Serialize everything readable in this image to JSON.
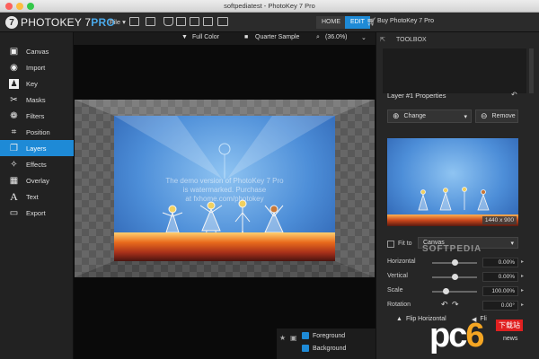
{
  "window": {
    "title": "softpediatest - PhotoKey 7 Pro"
  },
  "app": {
    "logo_num": "7",
    "logo_text": "PHOTOKEY 7",
    "logo_pro": "PRO"
  },
  "menu": {
    "file": "File ▾"
  },
  "tabs": [
    {
      "label": "HOME"
    },
    {
      "label": "EDIT"
    }
  ],
  "buy": "Buy PhotoKey 7 Pro",
  "sidebar": {
    "items": [
      {
        "label": "Canvas",
        "icon": "canvas-icon"
      },
      {
        "label": "Import",
        "icon": "camera-icon"
      },
      {
        "label": "Key",
        "icon": "key-icon"
      },
      {
        "label": "Masks",
        "icon": "scissors-icon"
      },
      {
        "label": "Filters",
        "icon": "filters-icon"
      },
      {
        "label": "Position",
        "icon": "crop-icon"
      },
      {
        "label": "Layers",
        "icon": "layers-icon"
      },
      {
        "label": "Effects",
        "icon": "wand-icon"
      },
      {
        "label": "Overlay",
        "icon": "grid-icon"
      },
      {
        "label": "Text",
        "icon": "text-icon"
      },
      {
        "label": "Export",
        "icon": "export-icon"
      }
    ],
    "active_index": 6
  },
  "canvas_toolbar": {
    "color_mode": "Full Color",
    "sample": "Quarter Sample",
    "zoom": "(36.0%)"
  },
  "canvas": {
    "watermark_lines": [
      "The demo version of PhotoKey 7 Pro",
      "is watermarked. Purchase",
      "at fxhome.com/photokey"
    ]
  },
  "bottom_layers": [
    {
      "label": "Foreground"
    },
    {
      "label": "Background"
    }
  ],
  "toolbox": {
    "title": "TOOLBOX"
  },
  "layer_props": {
    "title": "Layer #1 Properties",
    "change_label": "Change",
    "remove_label": "Remove",
    "dimensions": "1440 x 900",
    "fit_to_label": "Fit to",
    "fit_to_value": "Canvas",
    "horizontal_label": "Horizontal",
    "horizontal_value": "0.00%",
    "vertical_label": "Vertical",
    "vertical_value": "0.00%",
    "scale_label": "Scale",
    "scale_value": "100.00%",
    "rotation_label": "Rotation",
    "rotation_value": "0.00°",
    "flip_h_label": "Flip Horizontal",
    "flip_v_label": "Fli"
  },
  "overlay_brand": {
    "left": "pc",
    "right": "6",
    "sub": "下载站",
    "watermark": "SOFTPEDIA",
    "news": "news"
  },
  "colors": {
    "accent": "#1e8ad6",
    "panel": "#262626",
    "sidebar": "#222222"
  }
}
